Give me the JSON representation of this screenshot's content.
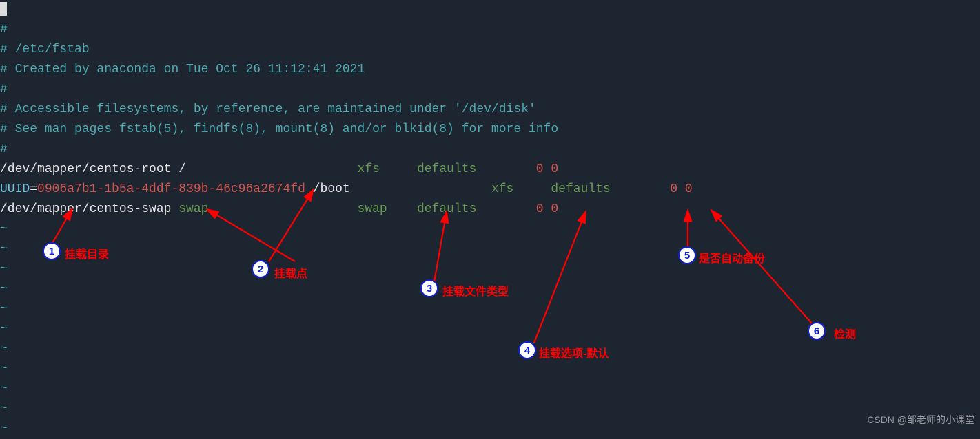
{
  "comments": [
    "#",
    "# /etc/fstab",
    "# Created by anaconda on Tue Oct 26 11:12:41 2021",
    "#",
    "# Accessible filesystems, by reference, are maintained under '/dev/disk'",
    "# See man pages fstab(5), findfs(8), mount(8) and/or blkid(8) for more info",
    "#"
  ],
  "fstab": {
    "row1": {
      "device": "/dev/mapper/centos-root",
      "mount": " /",
      "spaces1": "                       ",
      "type": "xfs",
      "spaces2": "     ",
      "opts": "defaults",
      "spaces3": "        ",
      "dump": "0 ",
      "pass": "0"
    },
    "row2": {
      "device_key": "UUID",
      "equals": "=",
      "device_val": "0906a7b1-1b5a-4ddf-839b-46c96a2674fd",
      "mount": " /boot",
      "spaces1": "                   ",
      "type": "xfs",
      "spaces2": "     ",
      "opts": "defaults",
      "spaces3": "        ",
      "dump": "0 ",
      "pass": "0"
    },
    "row3": {
      "device": "/dev/mapper/centos-swap",
      "mount": " swap",
      "spaces1": "                    ",
      "type": "swap",
      "spaces2": "    ",
      "opts": "defaults",
      "spaces3": "        ",
      "dump": "0 ",
      "pass": "0"
    }
  },
  "tilde": "~",
  "annotations": [
    {
      "n": "1",
      "label": "挂载目录"
    },
    {
      "n": "2",
      "label": "挂载点"
    },
    {
      "n": "3",
      "label": "挂载文件类型"
    },
    {
      "n": "4",
      "label": "挂载选项-默认"
    },
    {
      "n": "5",
      "label": "是否自动备份"
    },
    {
      "n": "6",
      "label": "检测"
    }
  ],
  "watermark": "CSDN @邹老师的小课堂"
}
